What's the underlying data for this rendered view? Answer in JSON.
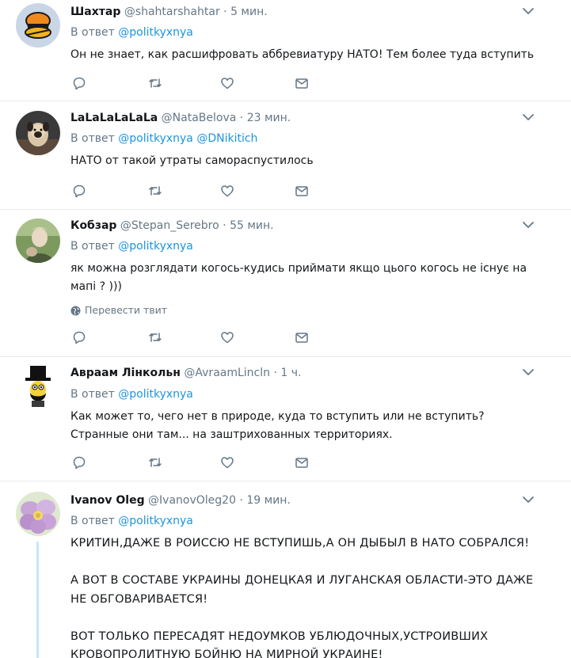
{
  "colors": {
    "link": "#1b95e0",
    "muted": "#657786",
    "text": "#14171a",
    "border": "#e6ecf0"
  },
  "tweets": [
    {
      "name": "Шахтар",
      "handle": "@shahtarshahtar",
      "dot": "·",
      "time": "5 мин.",
      "reply_prefix": "В ответ",
      "mentions": [
        "@politkyxnya"
      ],
      "text": [
        "Он не знает, как расшифровать аббревиатуру НАТО! Тем более туда вступить"
      ],
      "avatar_icon": "shakhtar-logo-icon"
    },
    {
      "name": "LaLaLaLaLaLa",
      "handle": "@NataBelova",
      "dot": "·",
      "time": "23 мин.",
      "reply_prefix": "В ответ",
      "mentions": [
        "@politkyxnya",
        "@DNikitich"
      ],
      "text": [
        "НАТО от такой утраты самораспустилось"
      ],
      "avatar_icon": "dog-photo-icon"
    },
    {
      "name": "Кобзар",
      "handle": "@Stepan_Serebro",
      "dot": "·",
      "time": "55 мин.",
      "reply_prefix": "В ответ",
      "mentions": [
        "@politkyxnya"
      ],
      "text": [
        "як можна розглядати когось-кудись приймати якщо цього когось не існує на",
        "мапі ? )))"
      ],
      "translate": "Перевести твит",
      "avatar_icon": "person-photo-icon"
    },
    {
      "name": "Авраам Лінкольн",
      "handle": "@AvraamLincln",
      "dot": "·",
      "time": "1 ч.",
      "reply_prefix": "В ответ",
      "mentions": [
        "@politkyxnya"
      ],
      "text": [
        "Как может то, чего нет в природе, куда то вступить или не вступить?",
        "Странные они там... на заштрихованных территориях."
      ],
      "avatar_icon": "lincoln-cartoon-icon"
    },
    {
      "name": "Ivanov Oleg",
      "handle": "@IvanovOleg20",
      "dot": "·",
      "time": "19 мин.",
      "reply_prefix": "В ответ",
      "mentions": [
        "@politkyxnya"
      ],
      "text": [
        "КРИТИН,ДАЖЕ В РОИССЮ НЕ ВСТУПИШЬ,А ОН ДЫБЫЛ В НАТО СОБРАЛСЯ!",
        "",
        "А ВОТ В СОСТАВЕ УКРАИНЫ ДОНЕЦКАЯ И ЛУГАНСКАЯ ОБЛАСТИ-ЭТО ДАЖЕ",
        "НЕ ОБГОВАРИВАЕТСЯ!",
        "",
        "ВОТ ТОЛЬКО ПЕРЕСАДЯТ НЕДОУМКОВ УБЛЮДОЧНЫХ,УСТРОИВШИХ",
        "КРОВОПРОЛИТНУЮ БОЙНЮ НА МИРНОЙ УКРАИНЕ!"
      ],
      "avatar_icon": "flower-photo-icon"
    }
  ]
}
